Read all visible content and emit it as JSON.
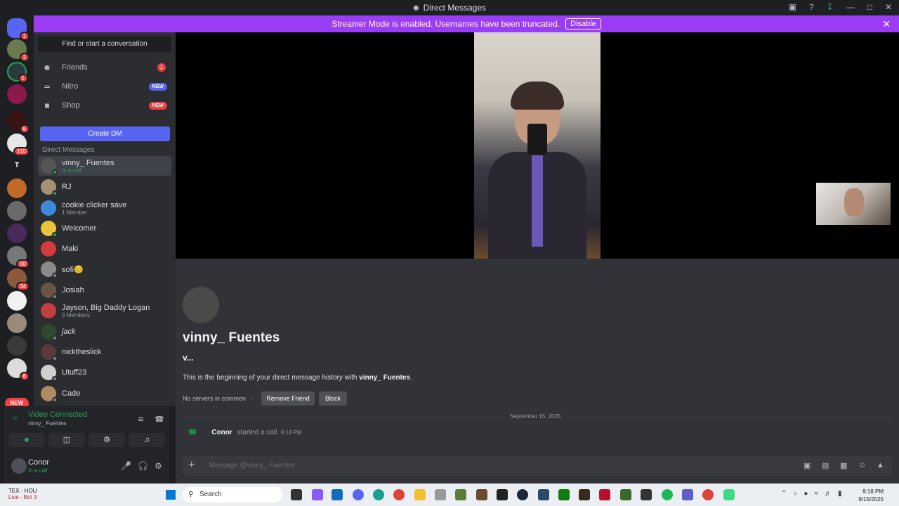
{
  "window": {
    "title": "Direct Messages"
  },
  "banner": {
    "text": "Streamer Mode is enabled. Usernames have been truncated.",
    "disable_label": "Disable"
  },
  "servers": {
    "badges": [
      "1",
      "1",
      "1",
      "6",
      "210",
      "60",
      "34",
      "6"
    ],
    "new_label": "NEW",
    "text_server": "T"
  },
  "sidebar": {
    "find_label": "Find or start a conversation",
    "nav": [
      {
        "label": "Friends",
        "count": "1"
      },
      {
        "label": "Nitro",
        "pill": "NEW"
      },
      {
        "label": "Shop",
        "pill": "NEW"
      }
    ],
    "create_dm_label": "Create DM",
    "dm_header": "Direct Messages",
    "dms": [
      {
        "name": "vinny_ Fuentes",
        "sub": "In a call"
      },
      {
        "name": "RJ",
        "sub": ""
      },
      {
        "name": "cookie clicker save",
        "sub": "1 Member"
      },
      {
        "name": "Welcomer",
        "sub": ""
      },
      {
        "name": "Maki",
        "sub": ""
      },
      {
        "name": "sofi😊",
        "sub": ""
      },
      {
        "name": "Josiah",
        "sub": ""
      },
      {
        "name": "Jayson, Big Daddy Logan",
        "sub": "3 Members"
      },
      {
        "name": "jack",
        "sub": ""
      },
      {
        "name": "nicktheslick",
        "sub": ""
      },
      {
        "name": "Utuff23",
        "sub": ""
      },
      {
        "name": "Cade",
        "sub": ""
      }
    ]
  },
  "voice": {
    "status": "Video Connected",
    "channel": "vinny_ Fuentes"
  },
  "user": {
    "name": "Conor",
    "status": "In a call"
  },
  "chat": {
    "display_name": "vinny_ Fuentes",
    "username": "v...",
    "beginning_prefix": "This is the beginning of your direct message history with ",
    "beginning_name": "vinny_ Fuentes",
    "beginning_suffix": ".",
    "no_servers": "No servers in common",
    "remove_friend": "Remove Friend",
    "block": "Block",
    "date": "September 15, 2025",
    "call_user": "Conor",
    "call_text": "started a call.",
    "call_time": "9:14 PM",
    "placeholder": "Message @vinny_ Fuentes"
  },
  "taskbar": {
    "weather_line1": "TEX · HOU",
    "weather_line2": "Live - Bot 3",
    "search_label": "Search",
    "time": "9:18 PM",
    "date": "9/15/2025"
  },
  "colors": {
    "banner": "#9b3df7",
    "blurple": "#5865f2",
    "online": "#23a55a",
    "badge": "#f23f43"
  }
}
